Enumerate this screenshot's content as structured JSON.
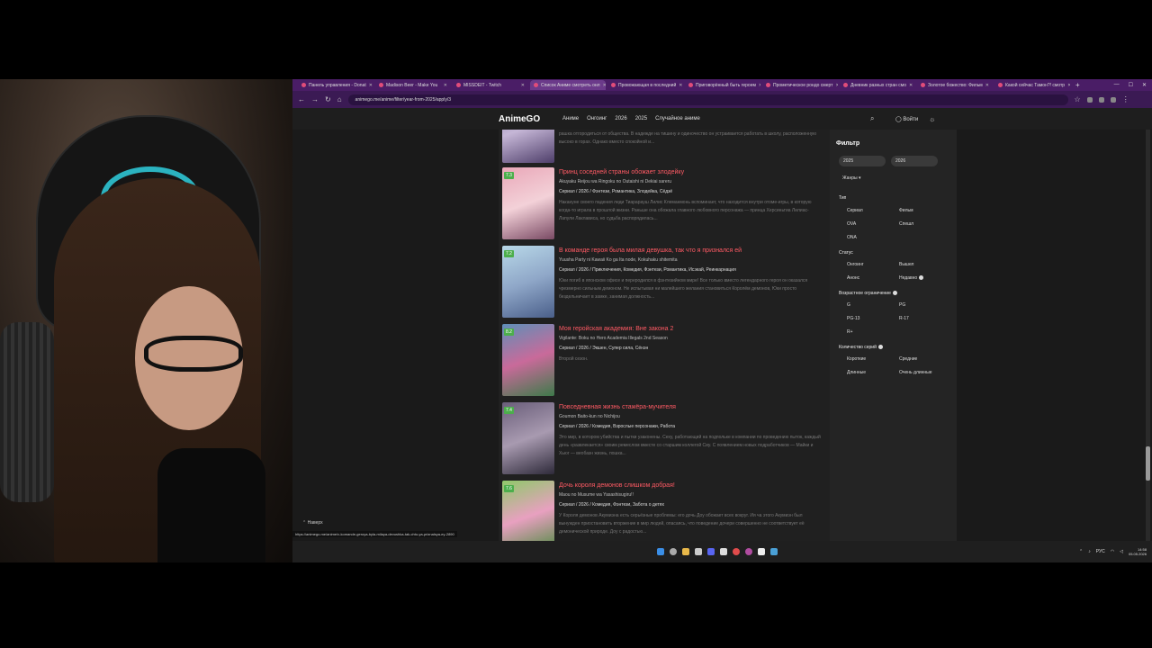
{
  "tabs": [
    {
      "label": "Панель управления - Donat"
    },
    {
      "label": "Madison Beer - Make You"
    },
    {
      "label": "MISSDEIT - Twitch"
    },
    {
      "label": "Список Аниме смотреть онл"
    },
    {
      "label": "Провожающая в последний"
    },
    {
      "label": "Приговорённый быть героем"
    },
    {
      "label": "Прометическое рондо смерт"
    },
    {
      "label": "Дневник разных стран смо"
    },
    {
      "label": "Золотое божество: Фильм"
    },
    {
      "label": "Какой сейчас Тамон?! смотр"
    }
  ],
  "url": "animego.me/anime/filter/year-from-2025/apply/3",
  "site": {
    "logo": "AnimeGO",
    "nav": [
      "Аниме",
      "Онгоинг",
      "2026",
      "2025",
      "Случайное аниме"
    ],
    "login": "Войти"
  },
  "top_desc": "рашка отгородиться от общества. В надежде на тишину и одиночество он устраивается работать в школу, расположенную высоко в горах. Однако вместо спокойной и...",
  "items": [
    {
      "title": "Принц соседней страны обожает злодейку",
      "orig": "Akuyaku Reijou wa Ringoku no Outaishi ni Dekiai sareru",
      "meta": "Сериал  /  2026  /  Фэнтези, Романтика, Злодейка, Сёдзё",
      "rating": "7.3",
      "desc": "Накануне своего падения леди Тиарарауш Лилис Клеманмонь вспоминает, что находится внутри отоме-игры, в которую когда-то играла в прошлой жизни. Раньше она обожала главного любовного персонажа — принца Херсиньтиа Лилиас-Лапули Лаклависа, но судьба распорядилась..."
    },
    {
      "title": "В команде героя была милая девушка, так что я признался ей",
      "orig": "Yuusha Party ni Kawaii Ko ga Ita node, Kokuhaku shitemita",
      "meta": "Сериал  /  2026  /  Приключения, Комедия, Фэнтези, Романтика, Исэкай, Реинкарнация",
      "rating": "7.2",
      "desc": "Юки погиб в японском офисе и переродился в фэнтезийном мире! Все только вместо легендарного героя он оказался чрезмерно сильным демоном. Не испытывая ни малейшего желания становиться Королём демонов, Юки просто бездельничает в замке, занимая должность..."
    },
    {
      "title": "Моя геройская академия: Вне закона 2",
      "orig": "Vigilante: Boku no Hero Academia Illegals 2nd Season",
      "meta": "Сериал  /  2026  /  Экшен, Супер сила, Сёнэн",
      "rating": "8.2",
      "desc": "Второй сезон."
    },
    {
      "title": "Повседневная жизнь стажёра-мучителя",
      "orig": "Goumon Baito-kun no Nichijou",
      "meta": "Сериал  /  2026  /  Комедия, Взрослые персонажи, Работа",
      "rating": "7.4",
      "desc": "Это мир, в котором убийства и пытки узаконены. Сеху, работающий на подпольке в компании по проведению пыток, каждый день «развлекается» своим ремеслом вместе со старшим коллегой Сиу. С появлением новых подработчиков — Майки и Хьюг — веобазн жизнь, пошка..."
    },
    {
      "title": "Дочь короля демонов слишком добрая!",
      "orig": "Maou no Musume wa Yasashisugiru!!",
      "meta": "Сериал  /  2026  /  Комедия, Фэнтези, Забота о детях",
      "rating": "7.6",
      "desc": "У Короля демонов Акумиэна есть серьёзные проблемы: его дочь Доу обожает всех вокруг. Ия ча этого Акумиэн был вынужден приостановить вторжение в мир людей, опасаясь, что поведение дочери совершенно не соответствует её демонической природе. Доу с радостью..."
    }
  ],
  "filter": {
    "heading": "Фильтр",
    "year_from": "2025",
    "year_to": "2026",
    "genres": "Жанры",
    "type_heading": "Тип",
    "types": [
      "Сериал",
      "Фильм",
      "OVA",
      "Спешл",
      "ONA"
    ],
    "status_heading": "Статус",
    "statuses": [
      "Онгоинг",
      "Вышел",
      "Анонс",
      "Недавно"
    ],
    "age_heading": "Возрастное ограничение",
    "ages": [
      "G",
      "PG",
      "PG-13",
      "R-17",
      "R+"
    ],
    "episodes_heading": "Количество серий",
    "episodes": [
      "Короткие",
      "Средние",
      "Длинные",
      "Очень длинные"
    ]
  },
  "to_top": "Наверх",
  "status_url": "https://animego.me/anime/v-komande-geroya-byla-milaya-devushka-tak-chto-ya-priznalsya-ey-2890",
  "tray": {
    "lang": "РУС",
    "time": "14:58",
    "date": "05.05.2026"
  },
  "colors": {
    "accent": "#ff5a64",
    "rating": "#4cae4c",
    "browser_frame": "#4a1d66"
  }
}
